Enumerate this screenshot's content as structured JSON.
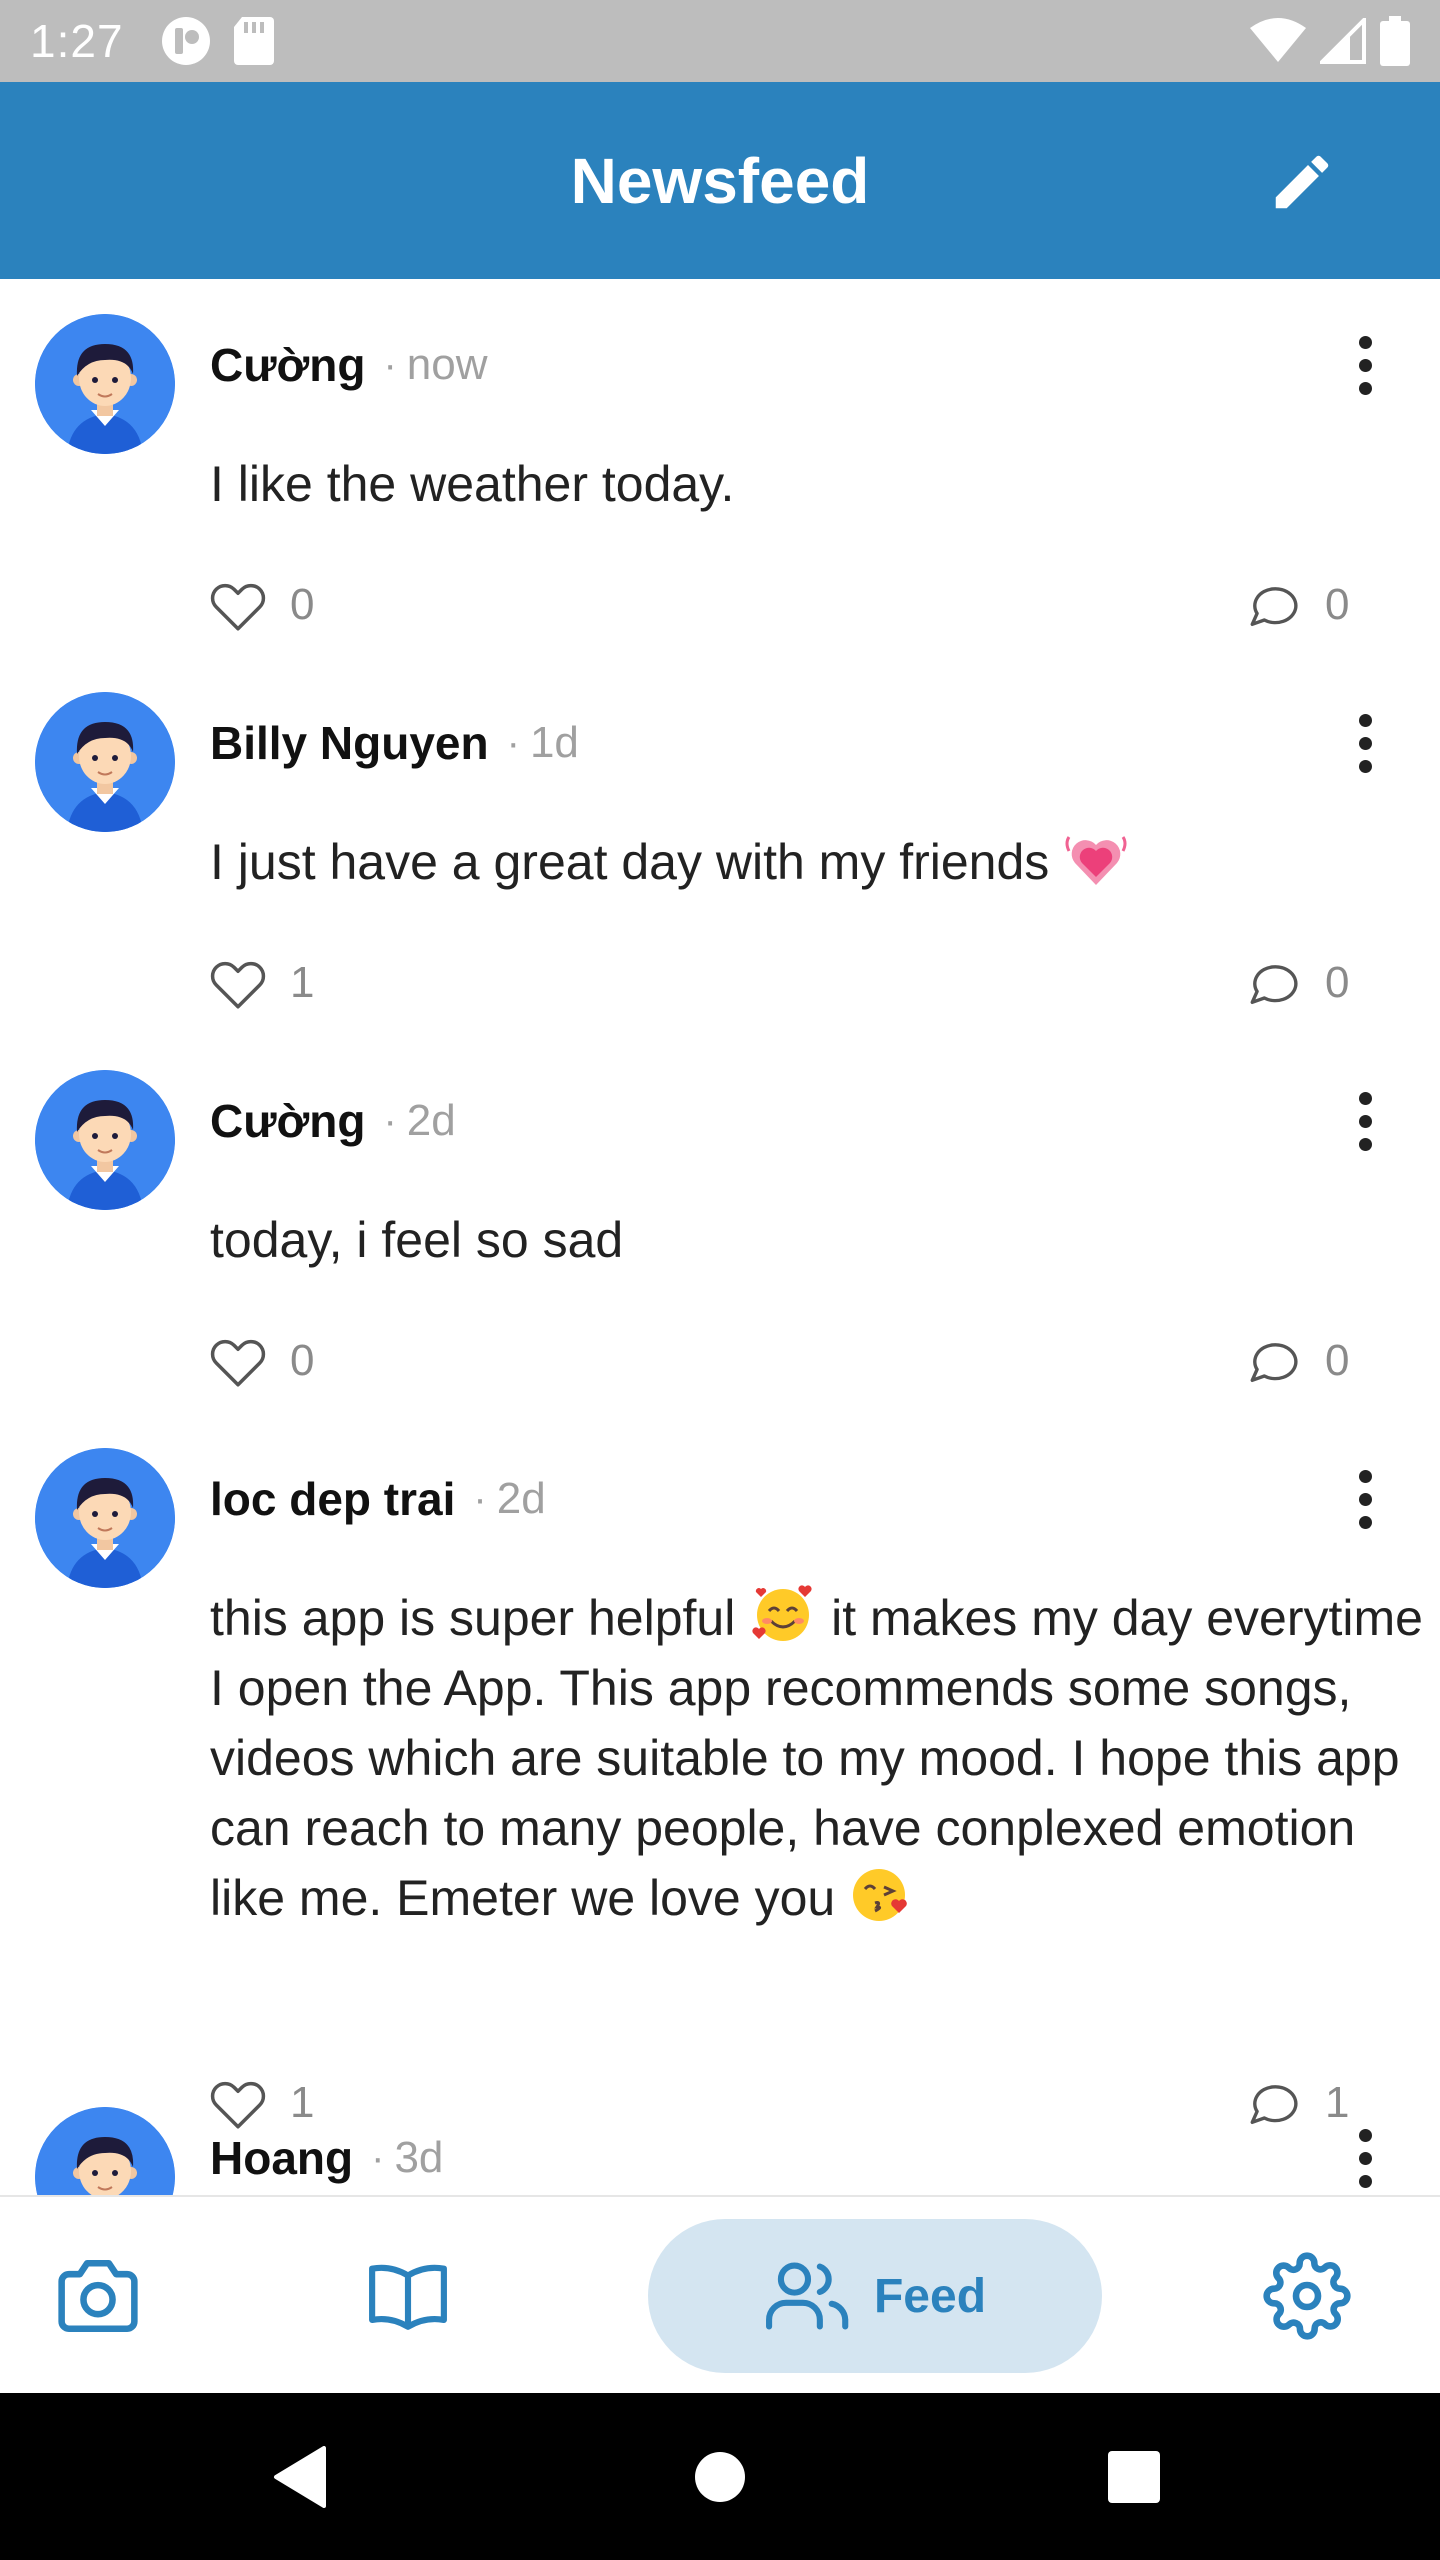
{
  "status_bar": {
    "time": "1:27"
  },
  "app_bar": {
    "title": "Newsfeed",
    "edit_icon": "pencil-icon"
  },
  "posts": [
    {
      "author": "Cường",
      "dot": "·",
      "time": "now",
      "body": "I like the weather today.",
      "likes": "0",
      "comments": "0"
    },
    {
      "author": "Billy Nguyen",
      "dot": "·",
      "time": "1d",
      "body": "I just have a great day with my friends",
      "emoji_end": "growing-heart-emoji",
      "likes": "1",
      "comments": "0"
    },
    {
      "author": "Cường",
      "dot": "·",
      "time": "2d",
      "body": "today, i feel so sad",
      "likes": "0",
      "comments": "0"
    },
    {
      "author": "loc dep trai",
      "dot": "·",
      "time": "2d",
      "body_part1": "this app is super helpful",
      "emoji_mid": "smiling-face-with-hearts-emoji",
      "body_part2": "it makes my day everytime I open the App. This app recommends some songs, videos which are suitable to my mood. I hope this app can reach to many people, have conplexed emotion like me. Emeter we love you",
      "emoji_end": "face-blowing-kiss-emoji",
      "likes": "1",
      "comments": "1"
    },
    {
      "author": "Hoang",
      "dot": "·",
      "time": "3d"
    }
  ],
  "bottom_nav": {
    "items": [
      {
        "icon": "camera-icon"
      },
      {
        "icon": "book-icon"
      },
      {
        "icon": "users-icon",
        "label": "Feed",
        "selected": true
      },
      {
        "icon": "gear-icon"
      }
    ]
  },
  "colors": {
    "app_bar": "#2b82bd",
    "status_bar": "#bdbdbd",
    "nav_selected_bg": "#d4e5f1",
    "avatar_bg": "#3d86f0"
  }
}
